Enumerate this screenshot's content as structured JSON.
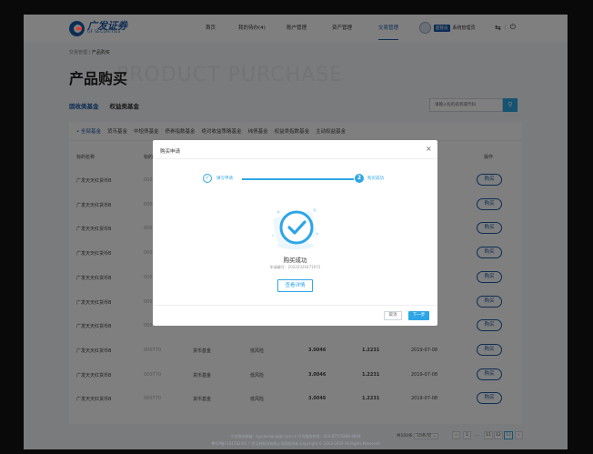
{
  "header": {
    "logo_cn": "广发证券",
    "logo_en": "GF SECURITIES",
    "nav": [
      "首页",
      "我的待办(4)",
      "账户管理",
      "资产管理",
      "交易管理"
    ],
    "active_nav": "交易管理",
    "user_badge": "超管员",
    "user_name": "系统管理员"
  },
  "page": {
    "breadcrumb_parent": "交易管理 / ",
    "breadcrumb_current": "产品购买",
    "title": "产品购买",
    "title_en": "PRODUCT PURCHASE",
    "category_tabs": [
      "固收类基金",
      "权益类基金"
    ],
    "search_placeholder": "请输入标的名称或代码",
    "sub_tabs": [
      "• 全部基金",
      "货币基金",
      "中短债基金",
      "债券指数基金",
      "绝对收益策略基金",
      "纯债基金",
      "权益类指数基金",
      "主动权益基金"
    ],
    "columns": [
      "标的名称",
      "标的",
      "操作"
    ],
    "rows": [
      {
        "name": "广发天天红货币B",
        "code": "000",
        "type": "",
        "risk": "",
        "nav": "",
        "acc": "",
        "date": "",
        "action": "购买"
      },
      {
        "name": "广发天天红货币B",
        "code": "000",
        "type": "",
        "risk": "",
        "nav": "",
        "acc": "",
        "date": "",
        "action": "购买"
      },
      {
        "name": "广发天天红货币B",
        "code": "000",
        "type": "",
        "risk": "",
        "nav": "",
        "acc": "",
        "date": "",
        "action": "购买"
      },
      {
        "name": "广发天天红货币B",
        "code": "000",
        "type": "",
        "risk": "",
        "nav": "",
        "acc": "",
        "date": "",
        "action": "购买"
      },
      {
        "name": "广发天天红货币B",
        "code": "000",
        "type": "",
        "risk": "",
        "nav": "",
        "acc": "",
        "date": "",
        "action": "购买"
      },
      {
        "name": "广发天天红货币B",
        "code": "000",
        "type": "",
        "risk": "",
        "nav": "",
        "acc": "",
        "date": "",
        "action": "购买"
      },
      {
        "name": "广发天天红货币B",
        "code": "000",
        "type": "",
        "risk": "",
        "nav": "",
        "acc": "",
        "date": "",
        "action": "购买"
      },
      {
        "name": "广发天天红货币B",
        "code": "000770",
        "type": "货币基金",
        "risk": "低风险",
        "nav": "3.0046",
        "acc": "1.2231",
        "date": "2019-07-08",
        "action": "购买"
      },
      {
        "name": "广发天天红货币B",
        "code": "000770",
        "type": "货币基金",
        "risk": "低风险",
        "nav": "3.0046",
        "acc": "1.2231",
        "date": "2019-07-08",
        "action": "购买"
      },
      {
        "name": "广发天天红货币B",
        "code": "000770",
        "type": "货币基金",
        "risk": "低风险",
        "nav": "3.0046",
        "acc": "1.2231",
        "date": "2019-07-08",
        "action": "购买"
      }
    ],
    "pagination": {
      "total": "共100条",
      "page_size": "10条/页",
      "pages": [
        "‹",
        "1",
        "…",
        "11",
        "12",
        "13",
        "›"
      ],
      "active_page": "13"
    },
    "footer_line1": "平台服务邮箱：typrdesign@gf.com.cn   平台服务热线：020-87555888-8888",
    "footer_line2": "粤ICP备11017824号 广发证券股份有限公司版权所有 Copyright © 2003-2019 All Rights Reserved"
  },
  "modal": {
    "title": "购买申请",
    "close": "×",
    "steps": [
      {
        "icon": "✓",
        "label": "填写申请"
      },
      {
        "icon": "2",
        "label": "购买成功"
      }
    ],
    "success_title": "购买成功",
    "success_no": "申请编号：20220320471972",
    "detail_button": "查看详情",
    "cancel_button": "取消",
    "next_button": "下一步"
  },
  "colors": {
    "brand": "#1a5aa8",
    "accent": "#2ea6e6"
  }
}
